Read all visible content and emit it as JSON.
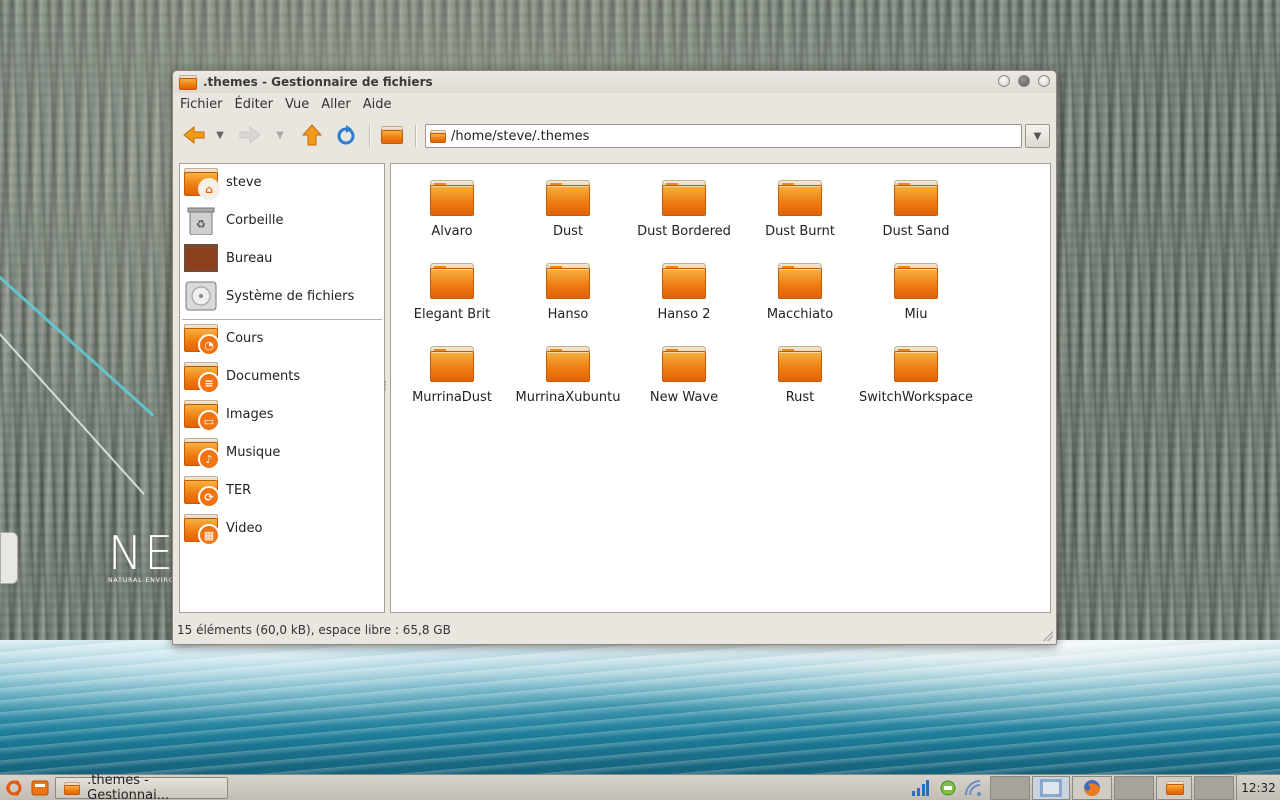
{
  "window": {
    "title": ".themes - Gestionnaire de fichiers",
    "menu": [
      "Fichier",
      "Éditer",
      "Vue",
      "Aller",
      "Aide"
    ],
    "address": "/home/steve/.themes",
    "status": "15 éléments (60,0 kB), espace libre : 65,8 GB"
  },
  "sidebar": {
    "places": [
      {
        "label": "steve",
        "icon": "home-folder-icon"
      },
      {
        "label": "Corbeille",
        "icon": "trash-icon"
      },
      {
        "label": "Bureau",
        "icon": "desktop-icon"
      },
      {
        "label": "Système de fichiers",
        "icon": "harddisk-icon"
      }
    ],
    "bookmarks": [
      {
        "label": "Cours",
        "icon": "cours-folder-icon"
      },
      {
        "label": "Documents",
        "icon": "documents-folder-icon"
      },
      {
        "label": "Images",
        "icon": "images-folder-icon"
      },
      {
        "label": "Musique",
        "icon": "music-folder-icon"
      },
      {
        "label": "TER",
        "icon": "ter-folder-icon"
      },
      {
        "label": "Video",
        "icon": "video-folder-icon"
      }
    ]
  },
  "files": [
    "Alvaro",
    "Dust",
    "Dust Bordered",
    "Dust Burnt",
    "Dust Sand",
    "Elegant Brit",
    "Hanso",
    "Hanso 2",
    "Macchiato",
    "Miu",
    "MurrinaDust",
    "MurrinaXubuntu",
    "New Wave",
    "Rust",
    "SwitchWorkspace"
  ],
  "taskbar": {
    "task_label": ".themes - Gestionnai...",
    "clock": "12:32"
  },
  "wallpaper": {
    "logo_text": "NE",
    "logo_sub": "NATURAL ENVIRO"
  },
  "colors": {
    "folder_orange": "#ee7d12",
    "accent_blue": "#2a7fcf"
  }
}
